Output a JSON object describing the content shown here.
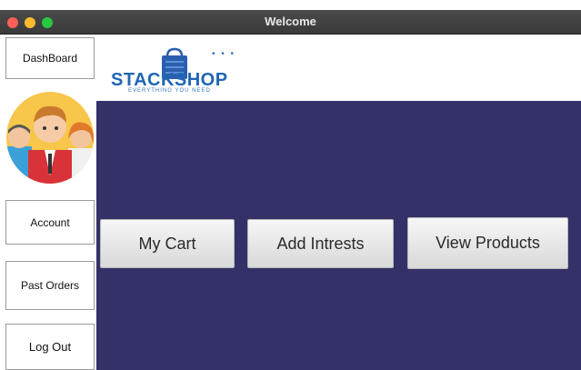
{
  "window": {
    "title": "Welcome"
  },
  "sidebar": {
    "items": [
      {
        "label": "DashBoard"
      },
      {
        "label": "Account"
      },
      {
        "label": "Past Orders"
      },
      {
        "label": "Log Out"
      }
    ]
  },
  "logo": {
    "name": "STACKSHOP",
    "tagline": "EVERYTHING YOU NEED",
    "dots": "• • •"
  },
  "actions": [
    {
      "label": "My Cart"
    },
    {
      "label": "Add Intrests"
    },
    {
      "label": "View Products"
    }
  ],
  "colors": {
    "main_background": "#333168",
    "logo_blue": "#2066b3",
    "avatar_background": "#f7c64a"
  }
}
